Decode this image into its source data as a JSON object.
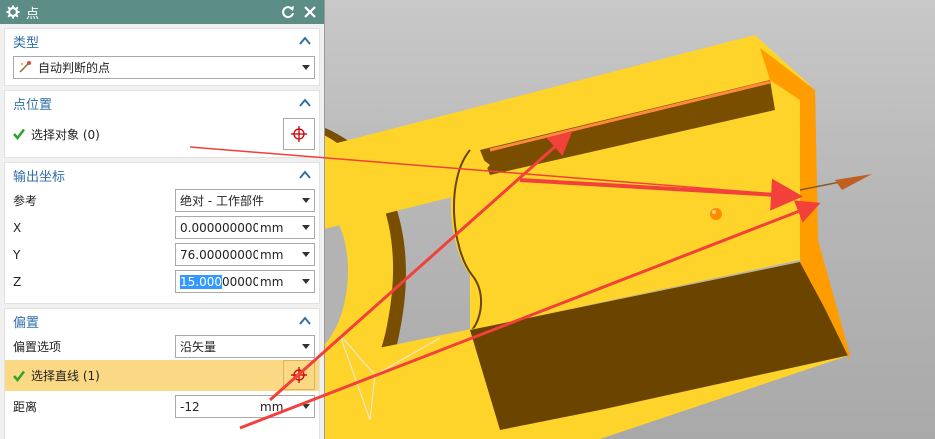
{
  "dialog": {
    "title": "点",
    "groups": {
      "type": {
        "heading": "类型",
        "selected": "自动判断的点"
      },
      "point_location": {
        "heading": "点位置",
        "select_object": "选择对象 (0)"
      },
      "output_coords": {
        "heading": "输出坐标",
        "reference_label": "参考",
        "reference_value": "绝对 - 工作部件",
        "x_label": "X",
        "x_value": "0.00000000000",
        "y_label": "Y",
        "y_value": "76.0000000000",
        "z_label": "Z",
        "z_value_selected": "15.000",
        "z_value_rest": "0000000",
        "unit": "mm"
      },
      "offset": {
        "heading": "偏置",
        "option_label": "偏置选项",
        "option_value": "沿矢量",
        "select_line": "选择直线 (1)",
        "distance_label": "距离",
        "distance_value": "-12",
        "unit": "mm"
      }
    }
  },
  "colors": {
    "titlebar": "#5b8d86",
    "heading": "#2f6fa8",
    "highlight_row": "#fbd984",
    "part_yellow": "#ffd42a",
    "annotation_red": "#f2403a"
  },
  "icons": [
    "gear-icon",
    "reset-icon",
    "close-icon",
    "collapse-icon",
    "check-icon",
    "point-pick-icon",
    "wand-icon"
  ]
}
